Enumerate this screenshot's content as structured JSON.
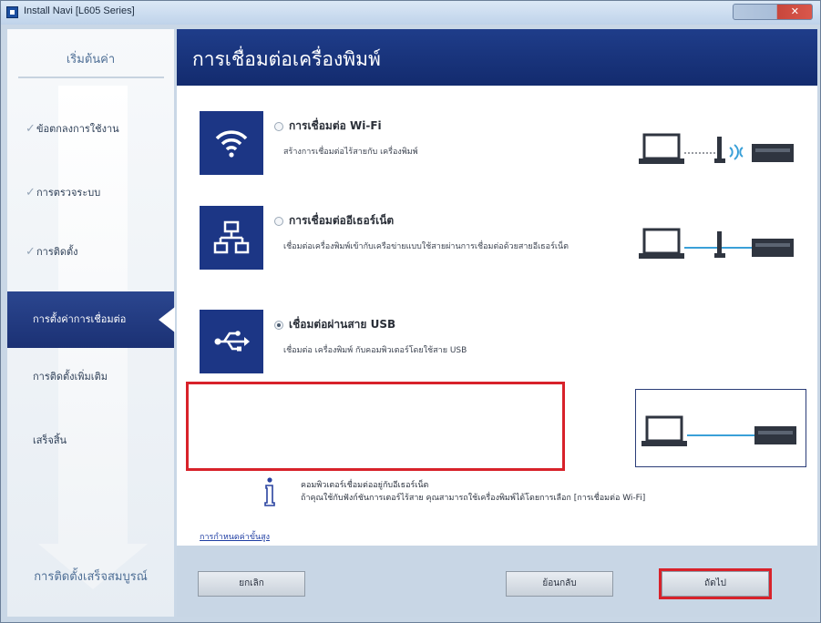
{
  "window": {
    "title": "Install Navi [L605 Series]"
  },
  "sidebar": {
    "title": "เริ่มต้นค่า",
    "steps": [
      {
        "label": "ข้อตกลงการใช้งาน",
        "done": true
      },
      {
        "label": "การตรวจระบบ",
        "done": true
      },
      {
        "label": "การติดตั้ง",
        "done": true
      },
      {
        "label": "การตั้งค่าการเชื่อมต่อ",
        "active": true
      },
      {
        "label": "การติดตั้งเพิ่มเติม",
        "done": false
      },
      {
        "label": "เสร็จสิ้น",
        "done": false
      }
    ],
    "footer": "การติดตั้งเสร็จสมบูรณ์"
  },
  "header": {
    "title": "การเชื่อมต่อเครื่องพิมพ์"
  },
  "options": {
    "wifi": {
      "title": "การเชื่อมต่อ Wi-Fi",
      "desc": "สร้างการเชื่อมต่อไร้สายกับ เครื่องพิมพ์"
    },
    "network": {
      "title": "การเชื่อมต่ออีเธอร์เน็ต",
      "desc": "เชื่อมต่อเครื่องพิมพ์เข้ากับเครือข่ายแบบใช้สายผ่านการเชื่อมต่อด้วยสายอีเธอร์เน็ต"
    },
    "usb": {
      "title": "เชื่อมต่อผ่านสาย USB",
      "desc": "เชื่อมต่อ เครื่องพิมพ์ กับคอมพิวเตอร์โดยใช้สาย USB"
    }
  },
  "info": {
    "line1": "คอมพิวเตอร์เชื่อมต่ออยู่กับอีเธอร์เน็ต",
    "line2": "ถ้าคุณใช้กับฟังก์ชันการเตอร์ไร้สาย คุณสามารถใช้เครื่องพิมพ์ได้โดยการเลือก [การเชื่อมต่อ Wi-Fi]"
  },
  "advanced_link": "การกำหนดค่าขั้นสูง",
  "buttons": {
    "cancel": "ยกเลิก",
    "back": "ย้อนกลับ",
    "next": "ถัดไป"
  },
  "colors": {
    "header_bg": "#1f3d8a",
    "active_step_bg": "#2b468f",
    "highlight_red": "#d8222a",
    "option_icon_bg": "#1c3685"
  }
}
